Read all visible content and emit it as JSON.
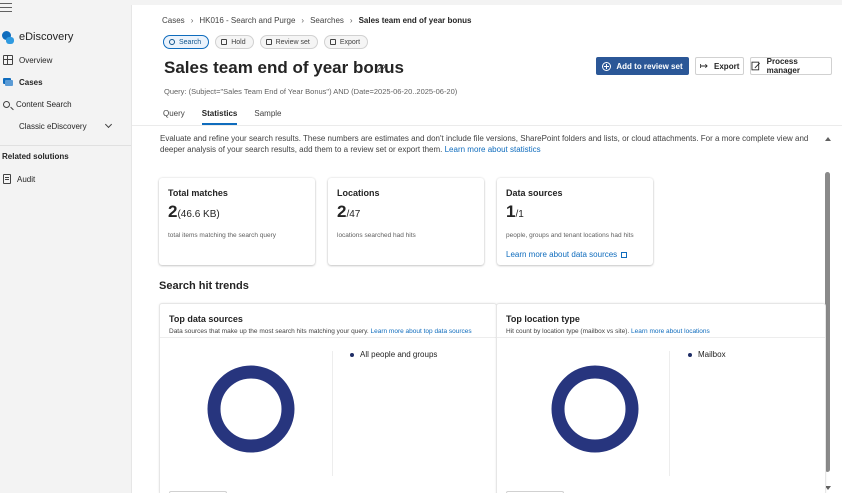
{
  "nav": {
    "app_name": "eDiscovery",
    "items": [
      {
        "label": "Overview"
      },
      {
        "label": "Cases"
      },
      {
        "label": "Content Search"
      },
      {
        "label": "Classic eDiscovery"
      }
    ],
    "related_heading": "Related solutions",
    "related_items": [
      {
        "label": "Audit"
      }
    ]
  },
  "breadcrumb": [
    "Cases",
    "HK016 - Search and Purge",
    "Searches",
    "Sales team end of year bonus"
  ],
  "pills": [
    "Search",
    "Hold",
    "Review set",
    "Export"
  ],
  "page": {
    "title": "Sales team end of year bonus",
    "query": "Query: (Subject=\"Sales Team End of Year Bonus\") AND (Date=2025-06-20..2025-06-20)"
  },
  "actions": {
    "add_to_review_set": "Add to review set",
    "export": "Export",
    "process_manager": "Process manager"
  },
  "tabs": [
    "Query",
    "Statistics",
    "Sample"
  ],
  "active_tab": "Statistics",
  "description": {
    "text": "Evaluate and refine your search results. These numbers are estimates and don't include file versions, SharePoint folders and lists, or cloud attachments. For a more complete view and deeper analysis of your search results, add them to a review set or export them.",
    "link": "Learn more about statistics"
  },
  "cards": [
    {
      "title": "Total matches",
      "value": "2",
      "sub": "(46.6 KB)",
      "desc": "total items matching the search query"
    },
    {
      "title": "Locations",
      "value": "2",
      "sub": "/47",
      "desc": "locations searched had hits"
    },
    {
      "title": "Data sources",
      "value": "1",
      "sub": "/1",
      "desc": "people, groups and tenant locations had hits",
      "link": "Learn more about data sources"
    }
  ],
  "trends": {
    "title": "Search hit trends",
    "panels": [
      {
        "title": "Top data sources",
        "desc": "Data sources that make up the most search hits matching your query.",
        "link": "Learn more about top data sources",
        "legend": "All people and groups"
      },
      {
        "title": "Top location type",
        "desc": "Hit count by location type (mailbox vs site).",
        "link": "Learn more about locations",
        "legend": "Mailbox"
      }
    ]
  },
  "colors": {
    "accent": "#0f6cbd",
    "primary_button": "#2b5797",
    "donut": "#27357e"
  }
}
